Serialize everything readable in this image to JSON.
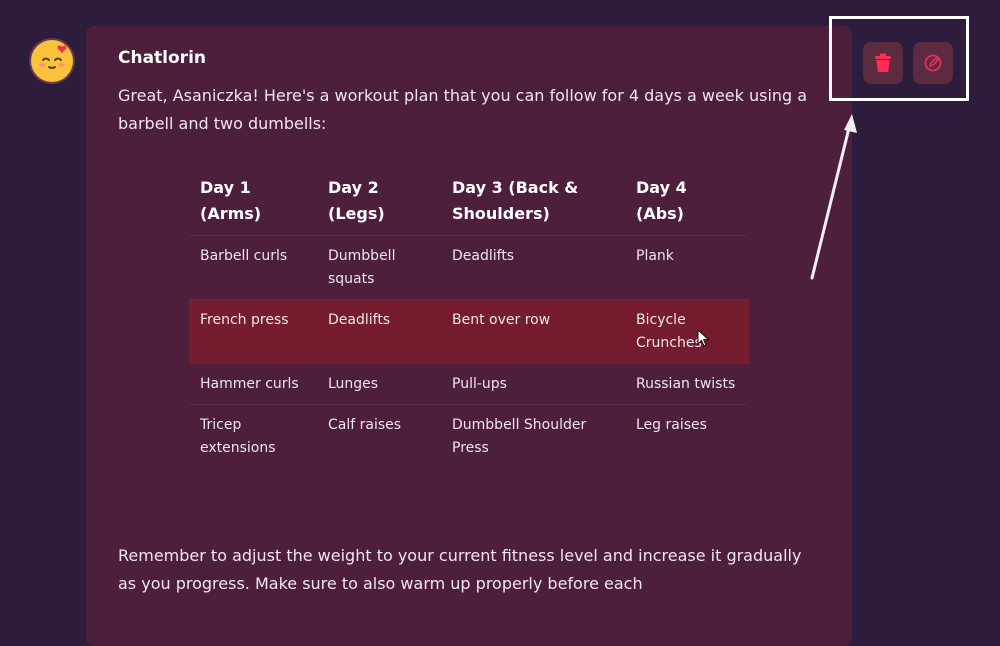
{
  "message": {
    "sender": "Chatlorin",
    "intro": "Great, Asaniczka! Here's a workout plan that you can follow for 4 days a week using a barbell and two dumbells:",
    "outro": "Remember to adjust the weight to your current fitness level and increase it gradually as you progress. Make sure to also warm up properly before each"
  },
  "workout_table": {
    "headers": [
      "Day 1 (Arms)",
      "Day 2 (Legs)",
      "Day 3 (Back & Shoulders)",
      "Day 4 (Abs)"
    ],
    "rows": [
      [
        "Barbell curls",
        "Dumbbell squats",
        "Deadlifts",
        "Plank"
      ],
      [
        "French press",
        "Deadlifts",
        "Bent over row",
        "Bicycle Crunches"
      ],
      [
        "Hammer curls",
        "Lunges",
        "Pull-ups",
        "Russian twists"
      ],
      [
        "Tricep extensions",
        "Calf raises",
        "Dumbbell Shoulder Press",
        "Leg raises"
      ]
    ]
  },
  "actions": {
    "delete_icon": "trash-icon",
    "edit_icon": "edit-pencil-icon"
  },
  "colors": {
    "page_bg": "#2e1c3c",
    "card_bg": "#4d1f3a",
    "highlight_row": "#751c2e",
    "delete_accent": "#ff2d55",
    "edit_accent": "#e0305a"
  }
}
